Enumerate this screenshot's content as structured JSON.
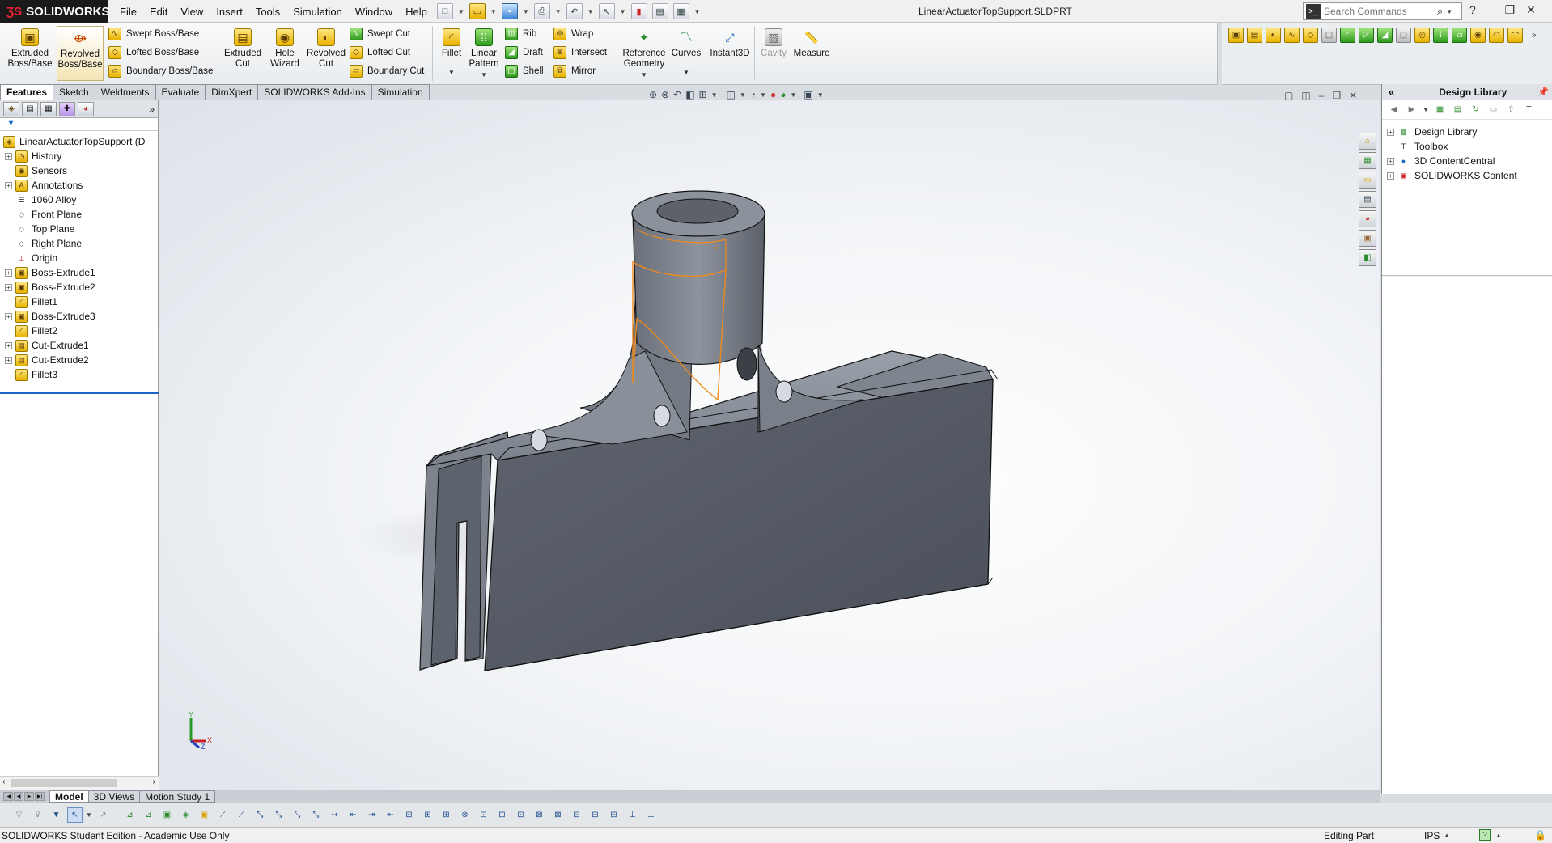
{
  "app": {
    "name": "SOLIDWORKS",
    "document_title": "LinearActuatorTopSupport.SLDPRT"
  },
  "menus": [
    "File",
    "Edit",
    "View",
    "Insert",
    "Tools",
    "Simulation",
    "Window",
    "Help"
  ],
  "search": {
    "placeholder": "Search Commands"
  },
  "ribbon": {
    "extruded_boss": "Extruded Boss/Base",
    "revolved_boss": "Revolved Boss/Base",
    "swept_boss": "Swept Boss/Base",
    "lofted_boss": "Lofted Boss/Base",
    "boundary_boss": "Boundary Boss/Base",
    "extruded_cut": "Extruded Cut",
    "hole_wizard": "Hole Wizard",
    "revolved_cut": "Revolved Cut",
    "swept_cut": "Swept Cut",
    "lofted_cut": "Lofted Cut",
    "boundary_cut": "Boundary Cut",
    "fillet": "Fillet",
    "linear_pattern": "Linear Pattern",
    "rib": "Rib",
    "draft": "Draft",
    "shell": "Shell",
    "wrap": "Wrap",
    "intersect": "Intersect",
    "mirror": "Mirror",
    "reference_geometry": "Reference Geometry",
    "curves": "Curves",
    "instant3d": "Instant3D",
    "cavity": "Cavity",
    "measure": "Measure"
  },
  "tabs": [
    "Features",
    "Sketch",
    "Weldments",
    "Evaluate",
    "DimXpert",
    "SOLIDWORKS Add-Ins",
    "Simulation"
  ],
  "active_tab": "Features",
  "feature_tree": {
    "root": "LinearActuatorTopSupport  (D",
    "items": [
      {
        "label": "History",
        "expandable": true,
        "icon": "history-folder-icon"
      },
      {
        "label": "Sensors",
        "expandable": false,
        "icon": "sensor-icon"
      },
      {
        "label": "Annotations",
        "expandable": true,
        "icon": "annotation-icon"
      },
      {
        "label": "1060 Alloy",
        "expandable": false,
        "icon": "material-icon"
      },
      {
        "label": "Front Plane",
        "expandable": false,
        "icon": "plane-icon"
      },
      {
        "label": "Top Plane",
        "expandable": false,
        "icon": "plane-icon"
      },
      {
        "label": "Right Plane",
        "expandable": false,
        "icon": "plane-icon"
      },
      {
        "label": "Origin",
        "expandable": false,
        "icon": "origin-icon"
      },
      {
        "label": "Boss-Extrude1",
        "expandable": true,
        "icon": "extrude-icon"
      },
      {
        "label": "Boss-Extrude2",
        "expandable": true,
        "icon": "extrude-icon"
      },
      {
        "label": "Fillet1",
        "expandable": false,
        "icon": "fillet-icon"
      },
      {
        "label": "Boss-Extrude3",
        "expandable": true,
        "icon": "extrude-icon"
      },
      {
        "label": "Fillet2",
        "expandable": false,
        "icon": "fillet-icon"
      },
      {
        "label": "Cut-Extrude1",
        "expandable": true,
        "icon": "cut-extrude-icon"
      },
      {
        "label": "Cut-Extrude2",
        "expandable": true,
        "icon": "cut-extrude-icon"
      },
      {
        "label": "Fillet3",
        "expandable": false,
        "icon": "fillet-icon"
      }
    ]
  },
  "design_library": {
    "title": "Design Library",
    "items": [
      {
        "label": "Design Library",
        "icon": "design-library-icon",
        "expandable": true
      },
      {
        "label": "Toolbox",
        "icon": "toolbox-icon",
        "expandable": false
      },
      {
        "label": "3D ContentCentral",
        "icon": "globe-icon",
        "expandable": true
      },
      {
        "label": "SOLIDWORKS Content",
        "icon": "solidworks-content-icon",
        "expandable": true
      }
    ]
  },
  "bottom_tabs": [
    "Model",
    "3D Views",
    "Motion Study 1"
  ],
  "active_bottom_tab": "Model",
  "status": {
    "left": "SOLIDWORKS Student Edition - Academic Use Only",
    "mode": "Editing Part",
    "units": "IPS"
  },
  "triad": {
    "y": "Y",
    "x": "X",
    "z": "Z"
  },
  "colors": {
    "part_body": "#5d626c",
    "selection_edge": "#f08a1c",
    "ribbon_active": "#f4e4b5",
    "accent_blue": "#1f64c8"
  }
}
